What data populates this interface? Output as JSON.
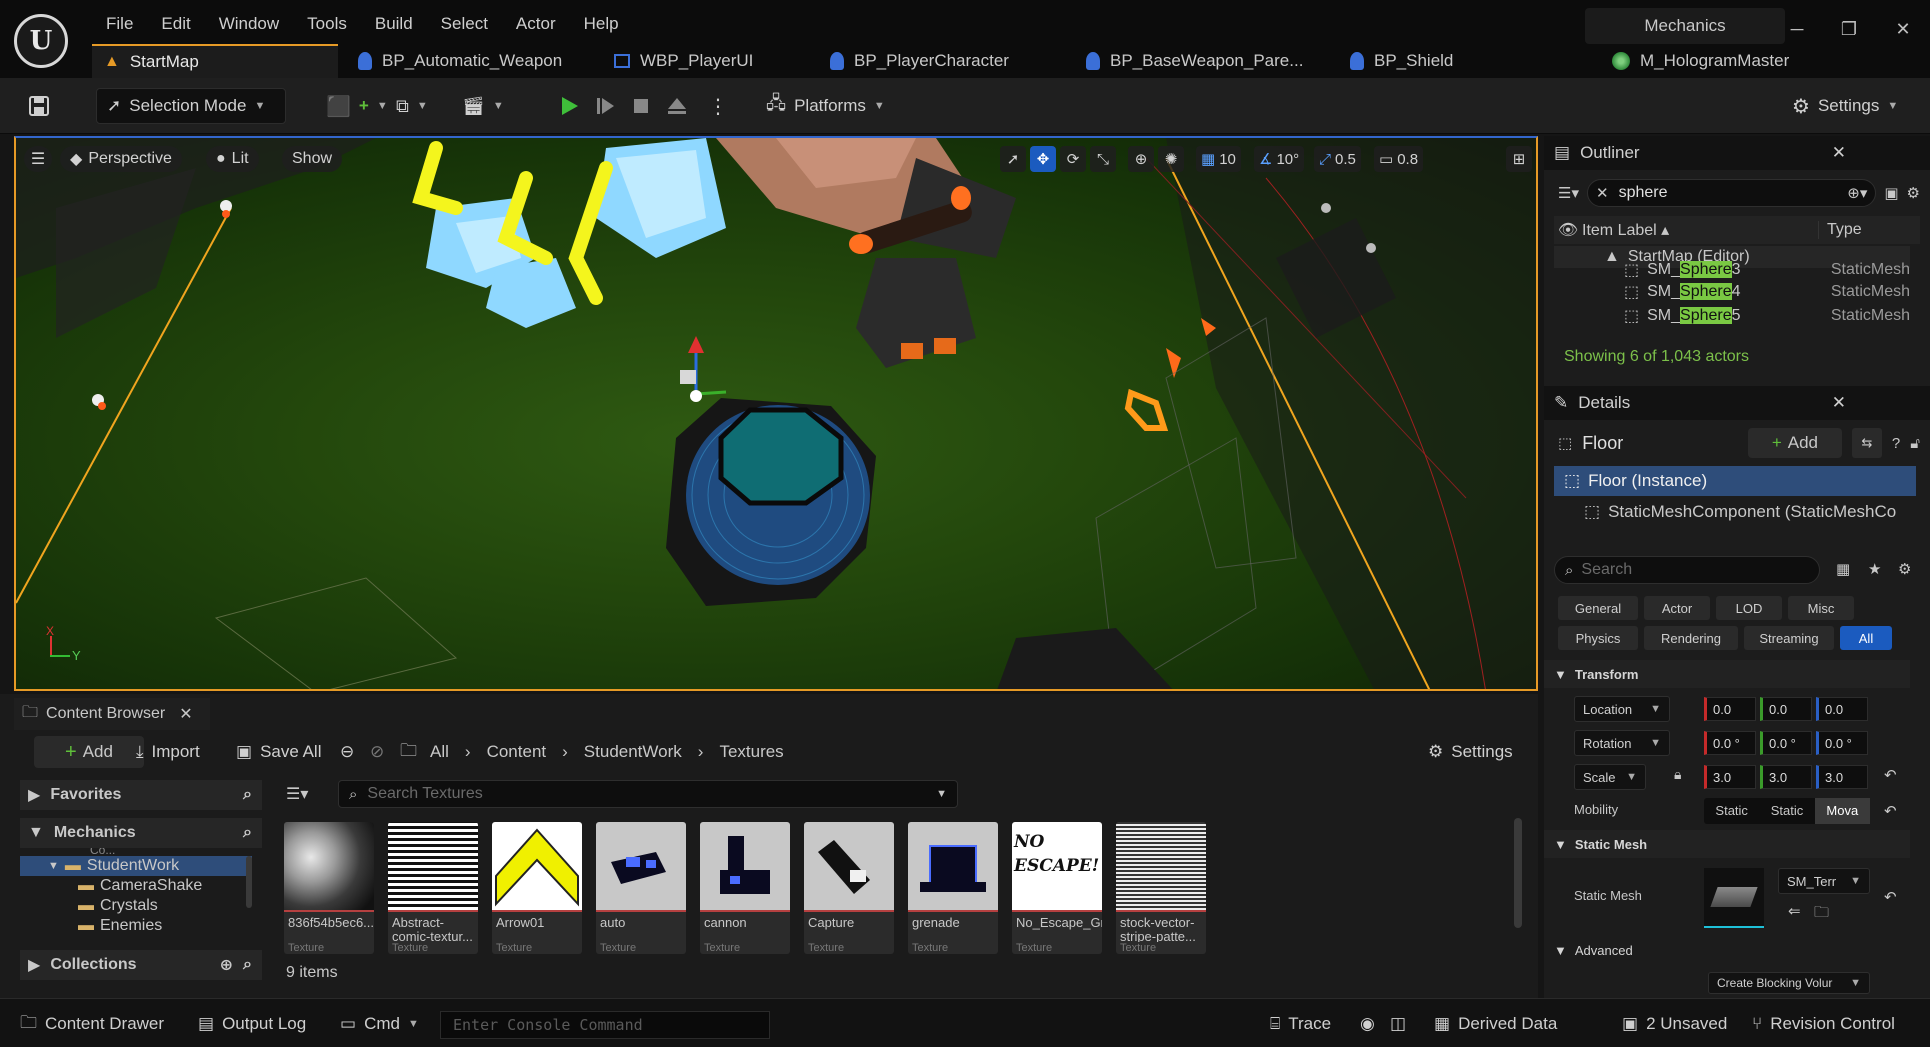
{
  "app": {
    "logo": "U",
    "project": "Mechanics"
  },
  "menu": [
    "File",
    "Edit",
    "Window",
    "Tools",
    "Build",
    "Select",
    "Actor",
    "Help"
  ],
  "tabs": [
    {
      "label": "StartMap",
      "icon": "level-icon",
      "color": "#e69a26"
    },
    {
      "label": "BP_Automatic_Weapon",
      "icon": "blueprint-icon",
      "color": "#3b6fd8"
    },
    {
      "label": "WBP_PlayerUI",
      "icon": "widget-blueprint-icon",
      "color": "#3b6fd8"
    },
    {
      "label": "BP_PlayerCharacter",
      "icon": "character-blueprint-icon",
      "color": "#3b6fd8"
    },
    {
      "label": "BP_BaseWeapon_Pare...",
      "icon": "blueprint-icon",
      "color": "#3b6fd8"
    },
    {
      "label": "BP_Shield",
      "icon": "blueprint-icon",
      "color": "#3b6fd8"
    },
    {
      "label": "M_HologramMaster",
      "icon": "material-icon",
      "color": "#3aa64a"
    }
  ],
  "toolbar": {
    "selection_mode": "Selection Mode",
    "platforms": "Platforms",
    "settings": "Settings"
  },
  "viewport": {
    "perspective": "Perspective",
    "lit": "Lit",
    "show": "Show",
    "grid_snap": "10",
    "rotation_snap": "10°",
    "scale_snap": "0.5",
    "camera_speed": "0.8",
    "axis_x": "X",
    "axis_y": "Y"
  },
  "outliner": {
    "title": "Outliner",
    "search_value": "sphere",
    "col_label": "Item Label ▴",
    "col_type": "Type",
    "root": "StartMap (Editor)",
    "items": [
      {
        "prefix": "SM_",
        "match": "Sphere",
        "suffix": "3",
        "type": "StaticMesh"
      },
      {
        "prefix": "SM_",
        "match": "Sphere",
        "suffix": "4",
        "type": "StaticMesh"
      },
      {
        "prefix": "SM_",
        "match": "Sphere",
        "suffix": "5",
        "type": "StaticMesh"
      }
    ],
    "status": "Showing 6 of 1,043 actors"
  },
  "details": {
    "title": "Details",
    "object": "Floor",
    "add": "Add",
    "instance": "Floor (Instance)",
    "component": "StaticMeshComponent (StaticMeshCo",
    "search_placeholder": "Search",
    "filters": [
      "General",
      "Actor",
      "LOD",
      "Misc",
      "Physics",
      "Rendering",
      "Streaming",
      "All"
    ],
    "transform_label": "Transform",
    "location_label": "Location",
    "rotation_label": "Rotation",
    "scale_label": "Scale",
    "location": [
      "0.0",
      "0.0",
      "0.0"
    ],
    "rotation": [
      "0.0 °",
      "0.0 °",
      "0.0 °"
    ],
    "scale": [
      "3.0",
      "3.0",
      "3.0"
    ],
    "mobility_label": "Mobility",
    "mobility": [
      "Static",
      "Static",
      "Mova"
    ],
    "static_mesh_section": "Static Mesh",
    "static_mesh_label": "Static Mesh",
    "static_mesh_value": "SM_Terr",
    "advanced_section": "Advanced",
    "blocking_volume": "Create Blocking Volur"
  },
  "content_browser": {
    "title": "Content Browser",
    "add": "Add",
    "import": "Import",
    "save_all": "Save All",
    "path": [
      "All",
      "Content",
      "StudentWork",
      "Textures"
    ],
    "settings": "Settings",
    "favorites": "Favorites",
    "mechanics": "Mechanics",
    "tree_cut": "Co...",
    "tree": [
      "StudentWork",
      "CameraShake",
      "Crystals",
      "Enemies"
    ],
    "collections": "Collections",
    "search_placeholder": "Search Textures",
    "item_count": "9 items",
    "assets": [
      {
        "name": "836f54b5ec6...",
        "type": "Texture",
        "thumb": "clouds"
      },
      {
        "name": "Abstract-comic-textur...",
        "type": "Texture",
        "thumb": "stripes"
      },
      {
        "name": "Arrow01",
        "type": "Texture",
        "thumb": "arrow"
      },
      {
        "name": "auto",
        "type": "Texture",
        "thumb": "gun"
      },
      {
        "name": "cannon",
        "type": "Texture",
        "thumb": "cannon"
      },
      {
        "name": "Capture",
        "type": "Texture",
        "thumb": "capture"
      },
      {
        "name": "grenade",
        "type": "Texture",
        "thumb": "grenade"
      },
      {
        "name": "No_Escape_Graffiti",
        "type": "Texture",
        "thumb": "graffiti"
      },
      {
        "name": "stock-vector-stripe-patte...",
        "type": "Texture",
        "thumb": "hstripes"
      }
    ],
    "graffiti_text": "NO ESCAPE!"
  },
  "statusbar": {
    "content_drawer": "Content Drawer",
    "output_log": "Output Log",
    "cmd": "Cmd",
    "console_placeholder": "Enter Console Command",
    "trace": "Trace",
    "derived_data": "Derived Data",
    "unsaved": "2 Unsaved",
    "revision_control": "Revision Control"
  }
}
